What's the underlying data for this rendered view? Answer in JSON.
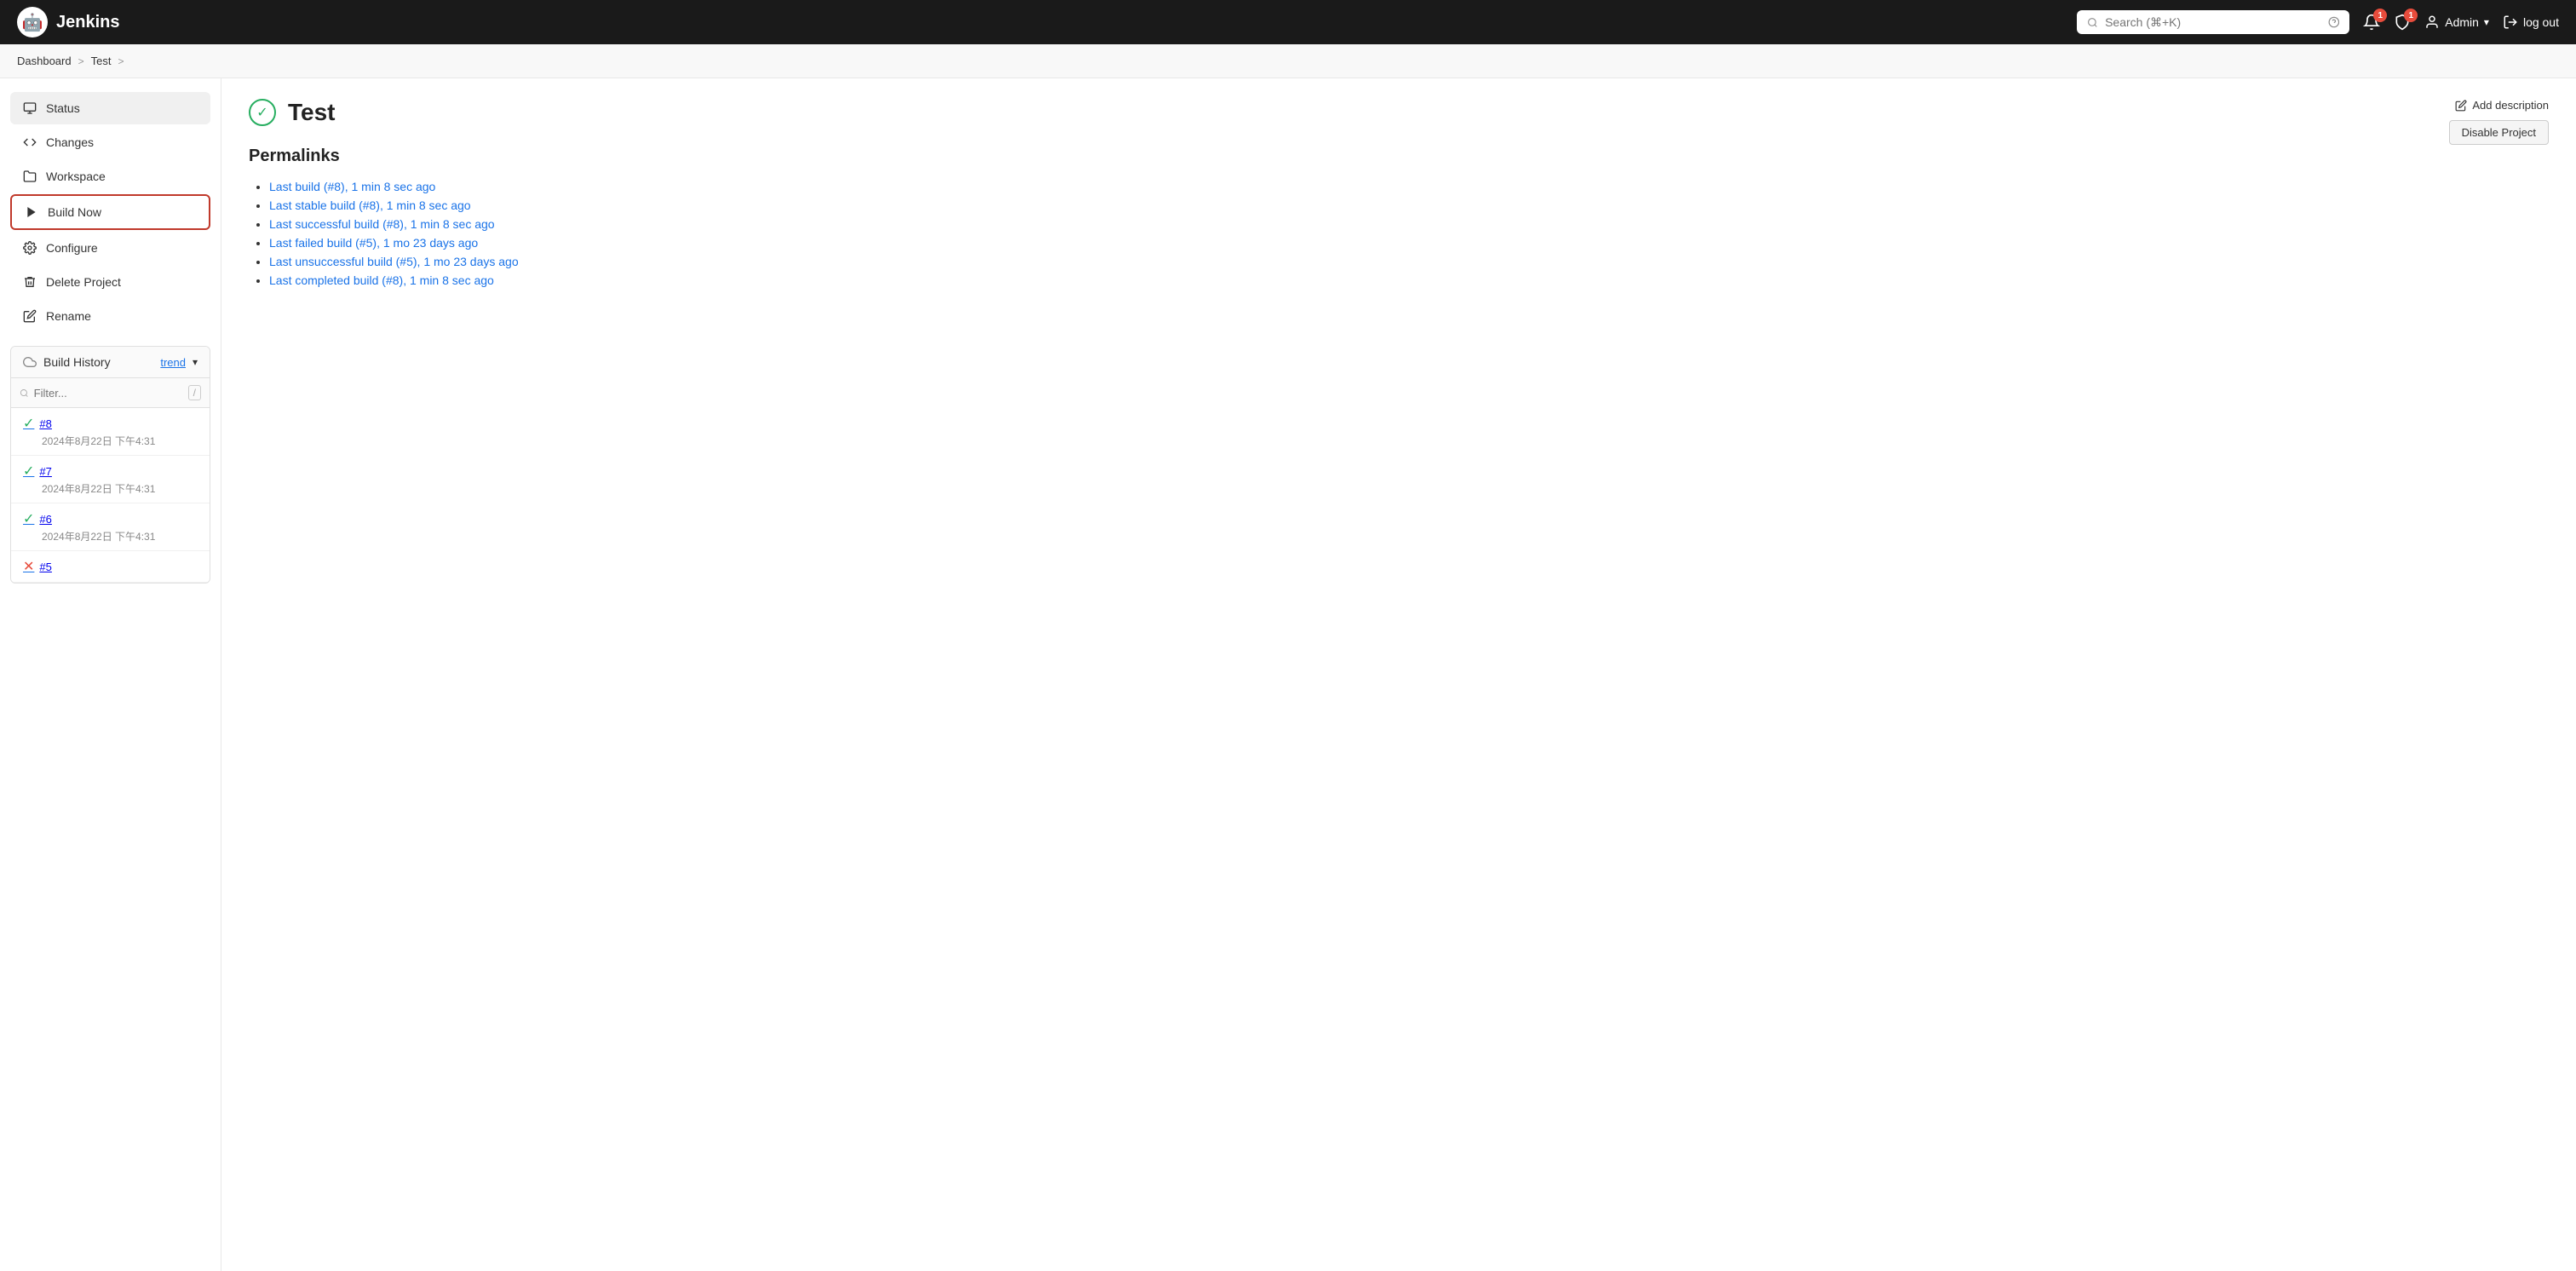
{
  "header": {
    "app_name": "Jenkins",
    "search_placeholder": "Search (⌘+K)",
    "notification_count": "1",
    "shield_count": "1",
    "user_label": "Admin",
    "logout_label": "log out"
  },
  "breadcrumb": {
    "dashboard": "Dashboard",
    "separator1": ">",
    "test": "Test",
    "separator2": ">"
  },
  "sidebar": {
    "items": [
      {
        "id": "status",
        "label": "Status",
        "icon": "☰"
      },
      {
        "id": "changes",
        "label": "Changes",
        "icon": "</>"
      },
      {
        "id": "workspace",
        "label": "Workspace",
        "icon": "📁"
      },
      {
        "id": "build-now",
        "label": "Build Now",
        "icon": "▷"
      },
      {
        "id": "configure",
        "label": "Configure",
        "icon": "⚙"
      },
      {
        "id": "delete-project",
        "label": "Delete Project",
        "icon": "🗑"
      },
      {
        "id": "rename",
        "label": "Rename",
        "icon": "✏"
      }
    ],
    "build_history_label": "Build History",
    "trend_label": "trend",
    "filter_placeholder": "Filter...",
    "filter_shortcut": "/"
  },
  "build_history": {
    "items": [
      {
        "id": "build8",
        "number": "#8",
        "date": "2024年8月22日 下午4:31",
        "status": "success"
      },
      {
        "id": "build7",
        "number": "#7",
        "date": "2024年8月22日 下午4:31",
        "status": "success"
      },
      {
        "id": "build6",
        "number": "#6",
        "date": "2024年8月22日 下午4:31",
        "status": "success"
      },
      {
        "id": "build5",
        "number": "#5",
        "date": "",
        "status": "fail"
      }
    ]
  },
  "main": {
    "title": "Test",
    "add_description_label": "Add description",
    "disable_project_label": "Disable Project",
    "permalinks_title": "Permalinks",
    "permalinks": [
      {
        "id": "last-build",
        "text": "Last build (#8), 1 min 8 sec ago"
      },
      {
        "id": "last-stable-build",
        "text": "Last stable build (#8), 1 min 8 sec ago"
      },
      {
        "id": "last-successful-build",
        "text": "Last successful build (#8), 1 min 8 sec ago"
      },
      {
        "id": "last-failed-build",
        "text": "Last failed build (#5), 1 mo 23 days ago"
      },
      {
        "id": "last-unsuccessful-build",
        "text": "Last unsuccessful build (#5), 1 mo 23 days ago"
      },
      {
        "id": "last-completed-build",
        "text": "Last completed build (#8), 1 min 8 sec ago"
      }
    ]
  }
}
